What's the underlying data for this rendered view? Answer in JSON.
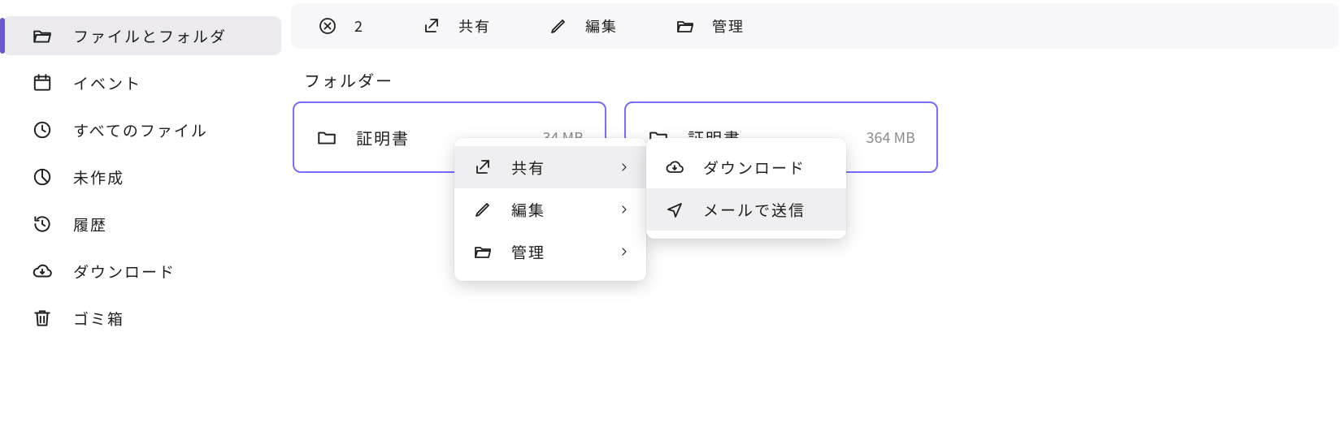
{
  "sidebar": {
    "items": [
      {
        "label": "ファイルとフォルダ"
      },
      {
        "label": "イベント"
      },
      {
        "label": "すべてのファイル"
      },
      {
        "label": "未作成"
      },
      {
        "label": "履歴"
      },
      {
        "label": "ダウンロード"
      },
      {
        "label": "ゴミ箱"
      }
    ]
  },
  "toolbar": {
    "count": "2",
    "share": "共有",
    "edit": "編集",
    "manage": "管理"
  },
  "section": {
    "title": "フォルダー"
  },
  "folders": [
    {
      "name": "証明書",
      "size": "34 MB"
    },
    {
      "name": "証明書",
      "size": "364 MB"
    }
  ],
  "menu1": {
    "share": "共有",
    "edit": "編集",
    "manage": "管理"
  },
  "menu2": {
    "download": "ダウンロード",
    "sendmail": "メールで送信"
  }
}
